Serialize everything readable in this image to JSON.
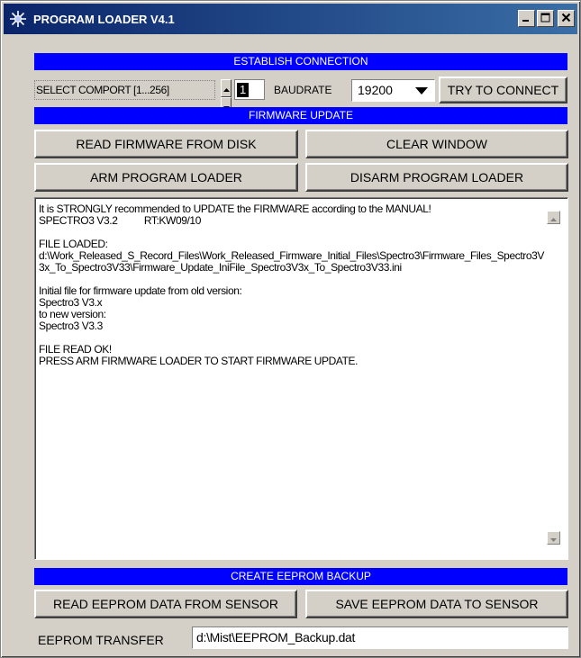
{
  "window": {
    "title": "PROGRAM LOADER V4.1",
    "controls": {
      "minimize_icon": "minimize-icon",
      "maximize_icon": "maximize-icon",
      "close_icon": "close-icon"
    }
  },
  "colors": {
    "section_bar": "#0000ff",
    "titlebar_start": "#0a246a",
    "titlebar_end": "#3a6ea5",
    "face": "#d4d0c8"
  },
  "connection": {
    "section_label": "ESTABLISH CONNECTION",
    "comport_label": "SELECT COMPORT [1...256]",
    "comport_value": "1",
    "baudrate_label": "BAUDRATE",
    "baudrate_value": "19200",
    "connect_button": "TRY TO CONNECT"
  },
  "firmware": {
    "section_label": "FIRMWARE UPDATE",
    "read_button": "READ FIRMWARE FROM DISK",
    "clear_button": "CLEAR WINDOW",
    "arm_button": "ARM PROGRAM LOADER",
    "disarm_button": "DISARM PROGRAM LOADER",
    "log_text": "It is STRONGLY recommended to UPDATE the FIRMWARE according to the MANUAL!\nSPECTRO3 V3.2          RT:KW09/10\n\nFILE LOADED:\nd:\\Work_Released_S_Record_Files\\Work_Released_Firmware_Initial_Files\\Spectro3\\Firmware_Files_Spectro3V3x_To_Spectro3V33\\Firmware_Update_IniFile_Spectro3V3x_To_Spectro3V33.ini\n\nInitial file for firmware update from old version:\nSpectro3 V3.x\nto new version:\nSpectro3 V3.3\n\nFILE READ OK!\nPRESS ARM FIRMWARE LOADER TO START FIRMWARE UPDATE."
  },
  "eeprom": {
    "section_label": "CREATE EEPROM BACKUP",
    "read_button": "READ EEPROM DATA FROM SENSOR",
    "save_button": "SAVE EEPROM DATA TO SENSOR",
    "transfer_label": "EEPROM TRANSFER",
    "transfer_path": "d:\\Mist\\EEPROM_Backup.dat"
  }
}
